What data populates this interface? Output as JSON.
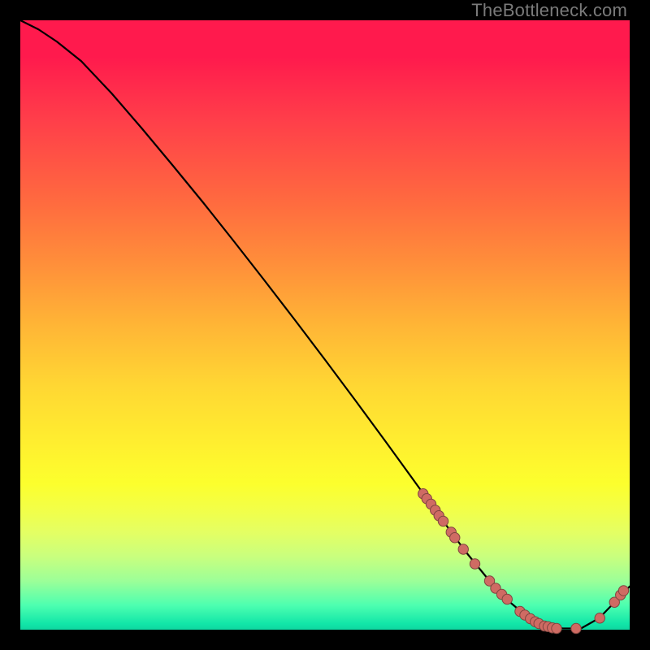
{
  "watermark": "TheBottleneck.com",
  "chart_data": {
    "type": "line",
    "title": "",
    "xlabel": "",
    "ylabel": "",
    "xlim": [
      0,
      100
    ],
    "ylim": [
      0,
      100
    ],
    "grid": false,
    "series": [
      {
        "name": "curve",
        "x": [
          0,
          3,
          6,
          10,
          15,
          20,
          25,
          30,
          35,
          40,
          45,
          50,
          55,
          60,
          65,
          70,
          73,
          77,
          80,
          83,
          86,
          89,
          92,
          95,
          98,
          100
        ],
        "y": [
          100,
          98.5,
          96.5,
          93.3,
          88,
          82.2,
          76.2,
          70.1,
          63.8,
          57.4,
          50.9,
          44.3,
          37.6,
          30.8,
          23.9,
          17,
          12.9,
          8.0,
          4.8,
          2.3,
          0.9,
          0.2,
          0.2,
          1.9,
          5.0,
          7.1
        ]
      }
    ],
    "dots": {
      "name": "highlight-points",
      "x": [
        66.1,
        66.7,
        67.4,
        68.1,
        68.7,
        69.4,
        70.7,
        71.3,
        72.7,
        74.6,
        77.0,
        78.0,
        79.0,
        79.9,
        82.0,
        82.8,
        83.7,
        84.5,
        85.1,
        86.0,
        86.6,
        87.3,
        88.0,
        91.2,
        95.1,
        97.5,
        98.5,
        99.0
      ],
      "y": [
        22.3,
        21.5,
        20.6,
        19.6,
        18.7,
        17.8,
        16.0,
        15.1,
        13.2,
        10.8,
        8.0,
        6.8,
        5.8,
        5.0,
        3.0,
        2.4,
        1.8,
        1.3,
        1.0,
        0.6,
        0.5,
        0.3,
        0.2,
        0.2,
        1.9,
        4.5,
        5.7,
        6.4
      ]
    }
  }
}
